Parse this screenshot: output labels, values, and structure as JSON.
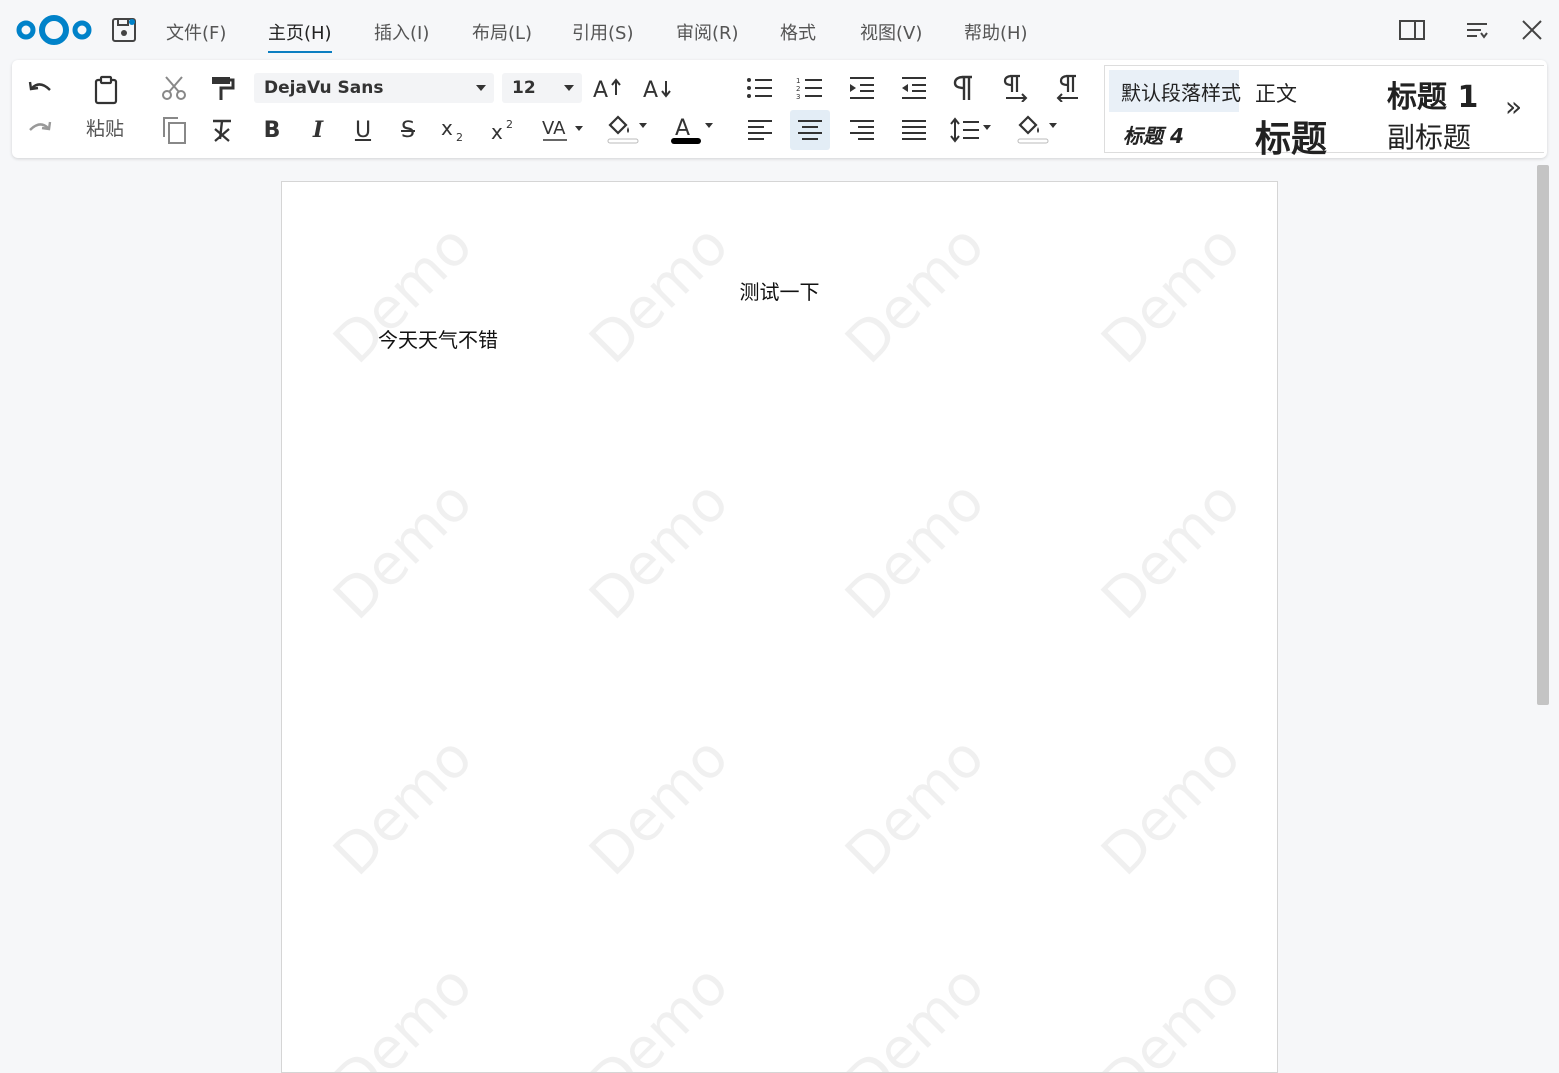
{
  "menu": {
    "items": [
      {
        "label": "文件(F)",
        "active": false
      },
      {
        "label": "主页(H)",
        "active": true
      },
      {
        "label": "插入(I)",
        "active": false
      },
      {
        "label": "布局(L)",
        "active": false
      },
      {
        "label": "引用(S)",
        "active": false
      },
      {
        "label": "审阅(R)",
        "active": false
      },
      {
        "label": "格式",
        "active": false
      },
      {
        "label": "视图(V)",
        "active": false
      },
      {
        "label": "帮助(H)",
        "active": false
      }
    ]
  },
  "toolbar": {
    "paste_label": "粘贴",
    "font_name": "DejaVu Sans",
    "font_size": "12",
    "bold": "B",
    "italic": "I",
    "underline": "U",
    "strike": "S",
    "alignment": "center"
  },
  "styles": {
    "default": "默认段落样式",
    "body": "正文",
    "h1": "标题 1",
    "h4": "标题 4",
    "title": "标题",
    "subtitle": "副标题",
    "more": "»"
  },
  "document": {
    "heading": "测试一下",
    "paragraph": "今天天气不错",
    "watermark": "Demo"
  },
  "colors": {
    "accent": "#0b7ec1",
    "logo": "#0082c9",
    "font_color_bar": "#000000"
  }
}
